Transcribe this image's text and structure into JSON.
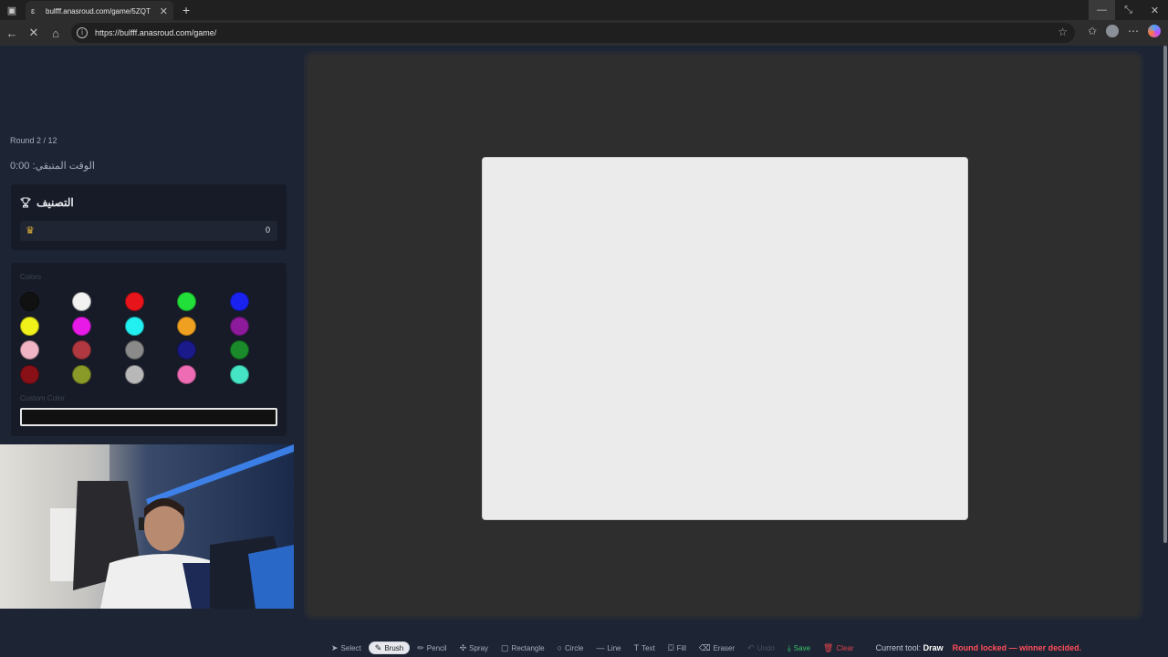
{
  "browser": {
    "tab_title": "bulfff.anasroud.com/game/5ZQT",
    "url": "https://bulfff.anasroud.com/game/"
  },
  "game": {
    "round": "Round 2 / 12",
    "timer": "الوقت المتبقي: 0:00",
    "ranking_title": "التصنيف",
    "ranking_score": "0",
    "colors_label": "Colors",
    "custom_color_label": "Custom Color",
    "palette": [
      "#111111",
      "#f2f2f2",
      "#e8141b",
      "#22e03a",
      "#1a22f0",
      "#f0f01a",
      "#e81ae8",
      "#22f0f0",
      "#f0a020",
      "#8c1a9a",
      "#f0b4c4",
      "#b03840",
      "#8a8a8a",
      "#1a1a8a",
      "#1a8a2a",
      "#8a1018",
      "#8a9a28",
      "#b8b8b8",
      "#ee6cb4",
      "#44e4c4"
    ]
  },
  "toolbar": {
    "tools": [
      {
        "label": "Select",
        "icon": "cursor-icon"
      },
      {
        "label": "Brush",
        "icon": "brush-icon",
        "active": true
      },
      {
        "label": "Pencil",
        "icon": "pencil-icon"
      },
      {
        "label": "Spray",
        "icon": "spray-icon"
      },
      {
        "label": "Rectangle",
        "icon": "rectangle-icon"
      },
      {
        "label": "Circle",
        "icon": "circle-icon"
      },
      {
        "label": "Line",
        "icon": "line-icon"
      },
      {
        "label": "Text",
        "icon": "text-icon"
      },
      {
        "label": "Fill",
        "icon": "fill-icon"
      },
      {
        "label": "Eraser",
        "icon": "eraser-icon"
      },
      {
        "label": "Undo",
        "icon": "undo-icon",
        "disabled": true
      },
      {
        "label": "Save",
        "icon": "save-icon",
        "kind": "save"
      },
      {
        "label": "Clear",
        "icon": "trash-icon",
        "kind": "clear"
      }
    ],
    "current_tool_label": "Current tool:",
    "current_tool_value": "Draw",
    "locked_message": "Round locked — winner decided."
  }
}
